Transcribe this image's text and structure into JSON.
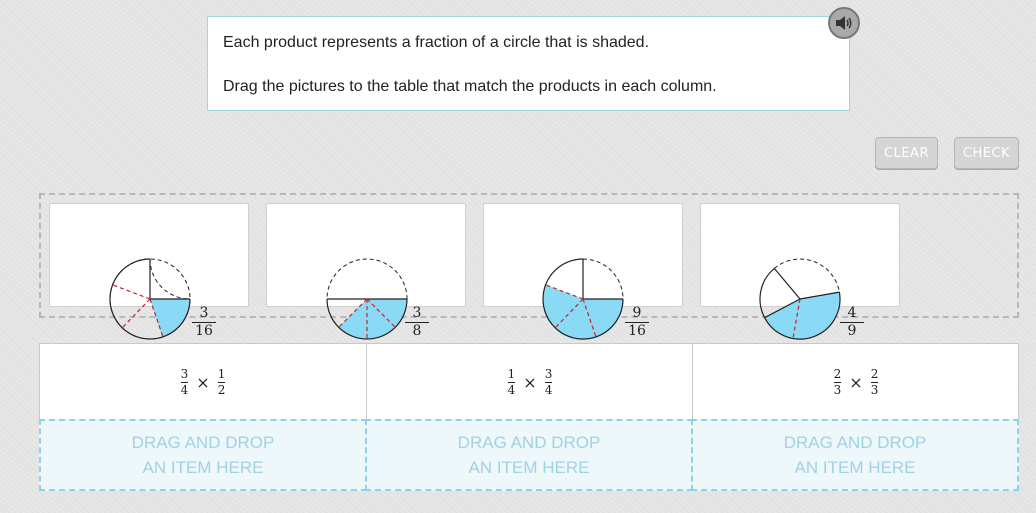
{
  "prompt": {
    "line1": "Each product represents a fraction of a circle that is shaded.",
    "line2": "Drag the pictures to the table that match the products in each column."
  },
  "icons": {
    "audio": "speaker-icon"
  },
  "buttons": {
    "clear": "CLEAR",
    "check": "CHECK"
  },
  "colors": {
    "shade": "#8ad9f5",
    "divider": "#c0272d",
    "drop_text": "#9fd3e2"
  },
  "items": [
    {
      "label_num": "3",
      "label_den": "16",
      "shaded_fraction": 0.1875
    },
    {
      "label_num": "3",
      "label_den": "8",
      "shaded_fraction": 0.375
    },
    {
      "label_num": "9",
      "label_den": "16",
      "shaded_fraction": 0.5625
    },
    {
      "label_num": "4",
      "label_den": "9",
      "shaded_fraction": 0.4444
    }
  ],
  "columns": [
    {
      "a_num": "3",
      "a_den": "4",
      "op": "×",
      "b_num": "1",
      "b_den": "2",
      "drop_line1": "DRAG AND DROP",
      "drop_line2": "AN ITEM HERE"
    },
    {
      "a_num": "1",
      "a_den": "4",
      "op": "×",
      "b_num": "3",
      "b_den": "4",
      "drop_line1": "DRAG AND DROP",
      "drop_line2": "AN ITEM HERE"
    },
    {
      "a_num": "2",
      "a_den": "3",
      "op": "×",
      "b_num": "2",
      "b_den": "3",
      "drop_line1": "DRAG AND DROP",
      "drop_line2": "AN ITEM HERE"
    }
  ]
}
